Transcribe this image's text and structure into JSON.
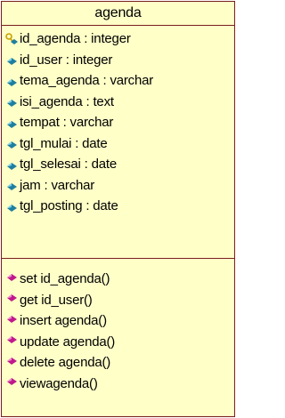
{
  "class_name": "agenda",
  "attributes": [
    {
      "text": "id_agenda : integer",
      "icon": "key-attribute-icon"
    },
    {
      "text": "id_user : integer",
      "icon": "attribute-icon"
    },
    {
      "text": "tema_agenda : varchar",
      "icon": "attribute-icon"
    },
    {
      "text": "isi_agenda : text",
      "icon": "attribute-icon"
    },
    {
      "text": "tempat : varchar",
      "icon": "attribute-icon"
    },
    {
      "text": "tgl_mulai : date",
      "icon": "attribute-icon"
    },
    {
      "text": "tgl_selesai : date",
      "icon": "attribute-icon"
    },
    {
      "text": "jam : varchar",
      "icon": "attribute-icon"
    },
    {
      "text": "tgl_posting : date",
      "icon": "attribute-icon"
    }
  ],
  "operations": [
    {
      "text": "set id_agenda()",
      "icon": "operation-icon"
    },
    {
      "text": "get id_user()",
      "icon": "operation-icon"
    },
    {
      "text": "insert agenda()",
      "icon": "operation-icon"
    },
    {
      "text": "update agenda()",
      "icon": "operation-icon"
    },
    {
      "text": "delete agenda()",
      "icon": "operation-icon"
    },
    {
      "text": "viewagenda()",
      "icon": "operation-icon"
    }
  ],
  "colors": {
    "box_fill": "#FFFFC8",
    "border": "#7A1E1E",
    "attribute_icon": "#1E7FA0",
    "operation_icon": "#C0188C",
    "key_icon": "#C8A000"
  }
}
